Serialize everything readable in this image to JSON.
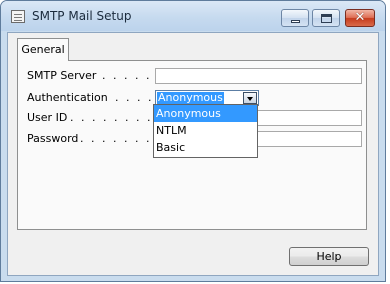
{
  "window": {
    "title": "SMTP Mail Setup",
    "icons": {
      "app": "table-icon",
      "minimize": "minimize-icon",
      "maximize": "maximize-icon",
      "close": "close-icon"
    },
    "close_glyph": "✕"
  },
  "tabs": [
    {
      "label": "General",
      "active": true
    }
  ],
  "form": {
    "smtp_server": {
      "label": "SMTP Server",
      "dots": ". . . . . .",
      "value": ""
    },
    "authentication": {
      "label": "Authentication",
      "dots": ". . . . .",
      "value": "Anonymous",
      "options": [
        "Anonymous",
        "NTLM",
        "Basic"
      ],
      "highlighted": "Anonymous"
    },
    "user_id": {
      "label": "User ID",
      "dots": ". . . . . . . . . .",
      "value": ""
    },
    "password": {
      "label": "Password",
      "dots": ". . . . . . . . .",
      "value": ""
    }
  },
  "buttons": {
    "help": "Help"
  },
  "colors": {
    "selection": "#3399ff",
    "title_bar": "#c9dcee",
    "close_button": "#c63c1e"
  }
}
